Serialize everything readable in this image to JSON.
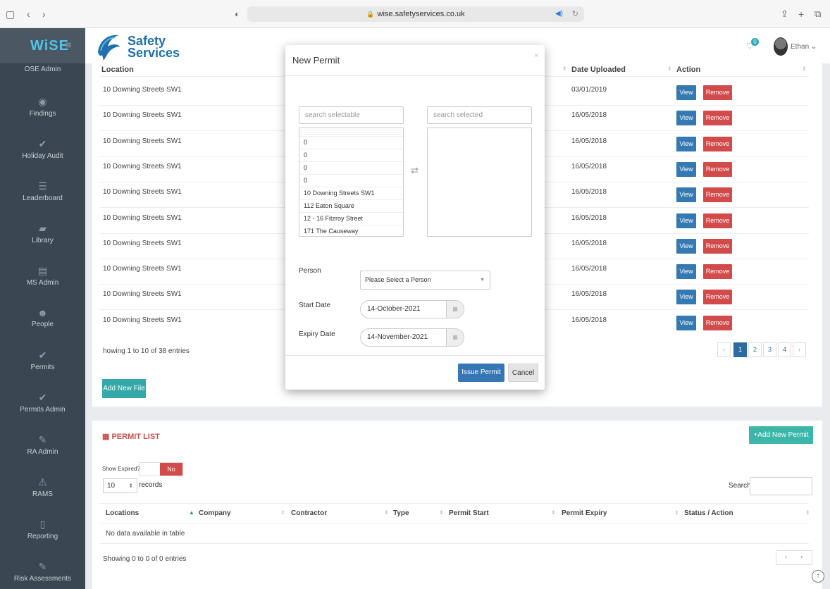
{
  "browser": {
    "url": "wise.safetyservices.co.uk",
    "icons": [
      "sidebar-icon",
      "back-icon",
      "forward-icon",
      "shield-icon",
      "lock-icon",
      "speaker-icon",
      "reload-icon",
      "share-icon",
      "new-tab-icon",
      "tabs-icon"
    ]
  },
  "sidebar": {
    "logo": "WiSE",
    "items": [
      {
        "label": "OSE Admin",
        "icon": "users-icon"
      },
      {
        "label": "Findings",
        "icon": "eye-icon"
      },
      {
        "label": "Holiday Audit",
        "icon": "check-icon"
      },
      {
        "label": "Leaderboard",
        "icon": "list-icon"
      },
      {
        "label": "Library",
        "icon": "book-icon"
      },
      {
        "label": "MS Admin",
        "icon": "document-icon"
      },
      {
        "label": "People",
        "icon": "people-icon"
      },
      {
        "label": "Permits",
        "icon": "check-icon"
      },
      {
        "label": "Permits Admin",
        "icon": "check-icon"
      },
      {
        "label": "RA Admin",
        "icon": "pencil-icon"
      },
      {
        "label": "RAMS",
        "icon": "warning-icon"
      },
      {
        "label": "Reporting",
        "icon": "file-icon"
      },
      {
        "label": "Risk Assessments",
        "icon": "pencil-icon"
      }
    ]
  },
  "header": {
    "brand_line1": "Safety",
    "brand_line2": "Services",
    "notification_count": "0",
    "user_name": "Ethan"
  },
  "files_table": {
    "columns": [
      "Location",
      "Date Uploaded",
      "Action"
    ],
    "rows": [
      {
        "location": "10 Downing Streets SW1",
        "date": "03/01/2019"
      },
      {
        "location": "10 Downing Streets SW1",
        "date": "16/05/2018"
      },
      {
        "location": "10 Downing Streets SW1",
        "date": "16/05/2018"
      },
      {
        "location": "10 Downing Streets SW1",
        "date": "16/05/2018"
      },
      {
        "location": "10 Downing Streets SW1",
        "date": "16/05/2018"
      },
      {
        "location": "10 Downing Streets SW1",
        "date": "16/05/2018"
      },
      {
        "location": "10 Downing Streets SW1",
        "date": "16/05/2018"
      },
      {
        "location": "10 Downing Streets SW1",
        "date": "16/05/2018"
      },
      {
        "location": "10 Downing Streets SW1",
        "date": "16/05/2018"
      },
      {
        "location": "10 Downing Streets SW1",
        "date": "16/05/2018"
      }
    ],
    "view_label": "View",
    "remove_label": "Remove",
    "showing": "howing 1 to 10 of 38 entries",
    "pages": [
      "‹",
      "1",
      "2",
      "3",
      "4",
      "›"
    ],
    "add_file_label": "Add New File"
  },
  "permit_list": {
    "title": "PERMIT LIST",
    "add_label": "Add New Permit",
    "show_expired_label": "Show Expired?",
    "toggle_value": "No",
    "length_value": "10",
    "records_label": "records",
    "search_label": "Search:",
    "columns": [
      "Locations",
      "Company",
      "Contractor",
      "Type",
      "Permit Start",
      "Permit Expiry",
      "Status / Action"
    ],
    "empty_text": "No data available in table",
    "showing": "Showing 0 to 0 of 0 entries"
  },
  "modal": {
    "title": "New Permit",
    "close_glyph": "×",
    "search_selectable_placeholder": "search selectable",
    "search_selected_placeholder": "search selected",
    "selectable_items": [
      "0",
      "0",
      "0",
      "0",
      "10 Downing Streets SW1",
      "112 Eaton Square",
      "12 - 16 Fitzroy Street",
      "171 The Causeway"
    ],
    "person_label": "Person",
    "person_value": "Please Select a Person",
    "start_label": "Start Date",
    "start_value": "14-October-2021",
    "expiry_label": "Expiry Date",
    "expiry_value": "14-November-2021",
    "issue_label": "Issue Permit",
    "cancel_label": "Cancel"
  }
}
